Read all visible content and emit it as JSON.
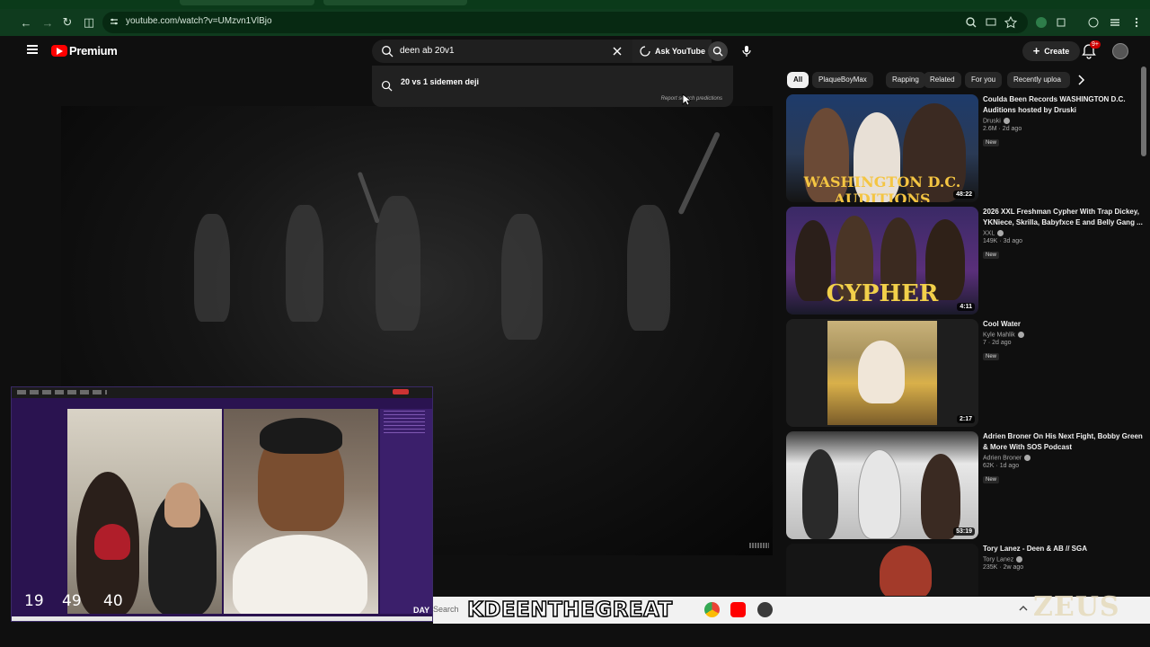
{
  "browser": {
    "url": "youtube.com/watch?v=UMzvn1VlBjo"
  },
  "header": {
    "logo_text": "Premium",
    "search_query": "deen ab 20v1",
    "ask_label": "Ask YouTube",
    "create_label": "Create",
    "notifications_count": "9+"
  },
  "suggestions": {
    "items": [
      "20 vs 1 sidemen deji"
    ],
    "report_text": "Report search predictions"
  },
  "chips": [
    "All",
    "PlaqueBoyMax",
    "Rapping",
    "Related",
    "For you",
    "Recently uploa"
  ],
  "recommendations": [
    {
      "title": "Coulda Been Records WASHINGTON D.C. Auditions hosted by Druski",
      "channel": "Druski",
      "views": "2.6M",
      "age": "2d ago",
      "badge": "New",
      "duration": "48:22",
      "thumb_text": "WASHINGTON D.C. AUDITIONS"
    },
    {
      "title": "2026 XXL Freshman Cypher With Trap Dickey, YKNiece, Skrilla, Babyfxce E and Belly Gang ...",
      "channel": "XXL",
      "views": "149K",
      "age": "3d ago",
      "badge": "New",
      "duration": "4:11",
      "thumb_text": "CYPHER"
    },
    {
      "title": "Cool Water",
      "channel": "Kyle Mahlik",
      "views": "7",
      "age": "2d ago",
      "badge": "New",
      "duration": "2:17",
      "thumb_text": ""
    },
    {
      "title": "Adrien Broner On His Next Fight, Bobby Green & More With SOS Podcast",
      "channel": "Adrien Broner",
      "views": "62K",
      "age": "1d ago",
      "badge": "New",
      "duration": "53:19",
      "thumb_text": ""
    },
    {
      "title": "Tory Lanez - Deen & AB // SGA",
      "channel": "Tory Lanez",
      "views": "235K",
      "age": "2w ago",
      "badge": "",
      "duration": "",
      "thumb_text": ""
    }
  ],
  "overlay": {
    "counters": [
      "19",
      "49",
      "40"
    ],
    "day_label": "DAY"
  },
  "taskbar": {
    "search_label": "Search",
    "banner_text": "KDEENTHEGREAT",
    "watermark": "ZEUS"
  },
  "colors": {
    "browser_chrome": "#0f3b1e",
    "yt_red": "#ff0000",
    "overlay_purple": "#2a1350"
  }
}
